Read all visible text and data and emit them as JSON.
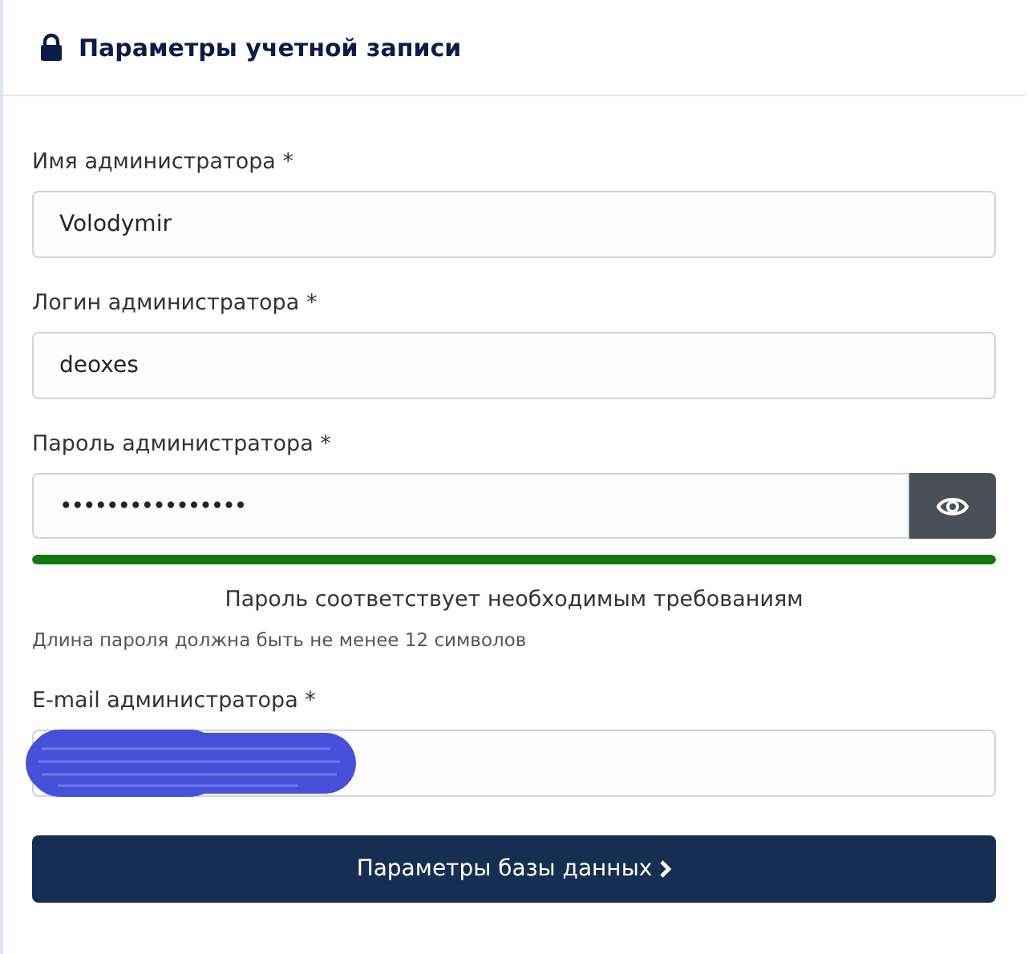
{
  "header": {
    "title": "Параметры учетной записи"
  },
  "fields": [
    {
      "kind": "text",
      "label": "Имя администратора *",
      "value": "Volodymir"
    },
    {
      "kind": "text",
      "label": "Логин администратора *",
      "value": "deoxes"
    },
    {
      "kind": "password",
      "label": "Пароль администратора *",
      "value": "••••••••••••••••",
      "strength": {
        "level": 1,
        "color": "#13790f",
        "message": "Пароль соответствует необходимым требованиям",
        "hint": "Длина пароля должна быть не менее 12 символов"
      }
    },
    {
      "kind": "text",
      "label": "E-mail администратора *",
      "redacted": true
    }
  ],
  "button": {
    "label": "Параметры базы данных"
  }
}
